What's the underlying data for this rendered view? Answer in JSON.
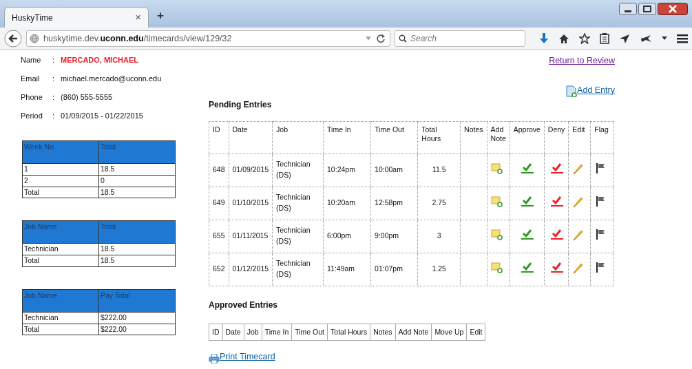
{
  "browser": {
    "tab": {
      "title": "HuskyTime",
      "close": "×",
      "selected": true
    },
    "new_tab": "+",
    "url": "huskytime.dev.**uconn.edu**/timecards/view/129/32",
    "search": {
      "placeholder": "Search"
    }
  },
  "profile": [
    {
      "label": "Name",
      "sep": ":",
      "value": "MERCADO, MICHAEL",
      "kind": "highlight"
    },
    {
      "label": "Email",
      "sep": ":",
      "value": "michael.mercado@uconn.edu",
      "kind": "plain"
    },
    {
      "label": "Phone",
      "sep": ":",
      "value": "(860) 555-5555",
      "kind": "plain"
    },
    {
      "label": "Period",
      "sep": ":",
      "value": "01/09/2015 - 01/22/2015",
      "kind": "plain"
    }
  ],
  "summary_tables": [
    {
      "columns": [
        "Week No",
        "Total"
      ],
      "rows": [
        [
          "1",
          "18.5"
        ],
        [
          "2",
          "0"
        ],
        [
          "Total",
          "18.5"
        ]
      ]
    },
    {
      "columns": [
        "Job Name",
        "Total"
      ],
      "rows": [
        [
          "Technician",
          "18.5"
        ],
        [
          "Total",
          "18.5"
        ]
      ]
    },
    {
      "columns": [
        "Job Name",
        "Pay Total"
      ],
      "rows": [
        [
          "Technician",
          "$222.00"
        ],
        [
          "Total",
          "$222.00"
        ]
      ]
    }
  ],
  "return_link": "Return to Review",
  "add_entry_link": "Add Entry",
  "pending": {
    "title": "Pending Entries",
    "columns": [
      {
        "label": "ID",
        "kind": "text"
      },
      {
        "label": "Date",
        "kind": "text"
      },
      {
        "label": "Job",
        "kind": "text"
      },
      {
        "label": "Time In",
        "kind": "text"
      },
      {
        "label": "Time Out",
        "kind": "text"
      },
      {
        "label": "Total Hours",
        "kind": "text"
      },
      {
        "label": "Notes",
        "kind": "text"
      },
      {
        "label": "Add Note",
        "kind": "add_note"
      },
      {
        "label": "Approve",
        "kind": "approve"
      },
      {
        "label": "Deny",
        "kind": "deny"
      },
      {
        "label": "Edit",
        "kind": "edit"
      },
      {
        "label": "Flag",
        "kind": "flag"
      }
    ],
    "rows": [
      {
        "id": "648",
        "date": "01/09/2015",
        "job": "Technician (DS)",
        "time_in": "10:24pm",
        "time_out": "10:00am",
        "total_hours": "11.5"
      },
      {
        "id": "649",
        "date": "01/10/2015",
        "job": "Technician (DS)",
        "time_in": "10:20am",
        "time_out": "12:58pm",
        "total_hours": "2.75"
      },
      {
        "id": "655",
        "date": "01/11/2015",
        "job": "Technician (DS)",
        "time_in": "6:00pm",
        "time_out": "9:00pm",
        "total_hours": "3"
      },
      {
        "id": "652",
        "date": "01/12/2015",
        "job": "Technician (DS)",
        "time_in": "11:49am",
        "time_out": "01:07pm",
        "total_hours": "1.25"
      }
    ]
  },
  "approved": {
    "title": "Approved Entries",
    "columns": [
      "ID",
      "Date",
      "Job",
      "Time In",
      "Time Out",
      "Total Hours",
      "Notes",
      "Add Note",
      "Move Up",
      "Edit"
    ]
  },
  "print_link": "Print Timecard"
}
